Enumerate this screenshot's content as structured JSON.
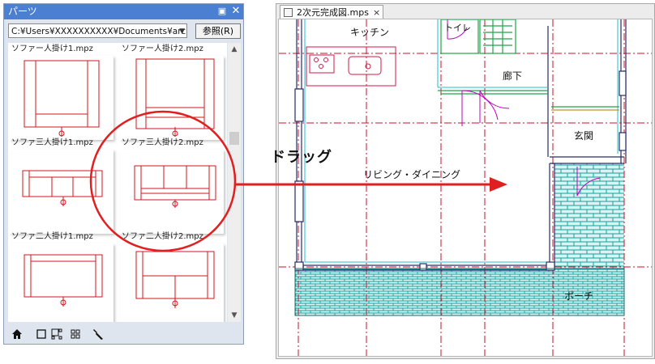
{
  "parts_panel": {
    "title": "パーツ",
    "pin_glyph": "▣",
    "close_glyph": "✕",
    "path_value": "C:¥Users¥XXXXXXXXXX¥Documents¥arc",
    "browse_label": "参照(R)",
    "items": [
      {
        "label": "ソファー人掛け1.mpz",
        "type": "sofa-single"
      },
      {
        "label": "ソファー人掛け2.mpz",
        "type": "sofa-single-2"
      },
      {
        "label": "ソファ三人掛け1.mpz",
        "type": "sofa-three"
      },
      {
        "label": "ソファ三人掛け2.mpz",
        "type": "sofa-three-2"
      },
      {
        "label": "ソファ二人掛け1.mpz",
        "type": "sofa-two"
      },
      {
        "label": "ソファ二人掛け2.mpz",
        "type": "sofa-two-2"
      }
    ],
    "toolbar_icons": [
      "home-icon",
      "square-icon",
      "layout-icon",
      "grid-icon",
      "wrench-icon"
    ]
  },
  "drag_text": "ドラッグ",
  "document": {
    "tab_name": "2次元完成図.mps",
    "tab_close": "×",
    "rooms": {
      "kitchen": "キッチン",
      "toilet": "トイレ",
      "hall": "廊下",
      "entrance": "玄関",
      "living": "リビング・ダイニング",
      "porch": "ポーチ"
    }
  },
  "colors": {
    "title_bar": "#4a7fd1",
    "part_line": "#d0141e",
    "annotation": "#e02020",
    "wall": "#2a2a6a",
    "grid_line": "#c8102e",
    "tile": "#17a0a0",
    "tile_bg": "#c8f0ee",
    "green": "#1fa34a",
    "magenta": "#c000c0"
  }
}
